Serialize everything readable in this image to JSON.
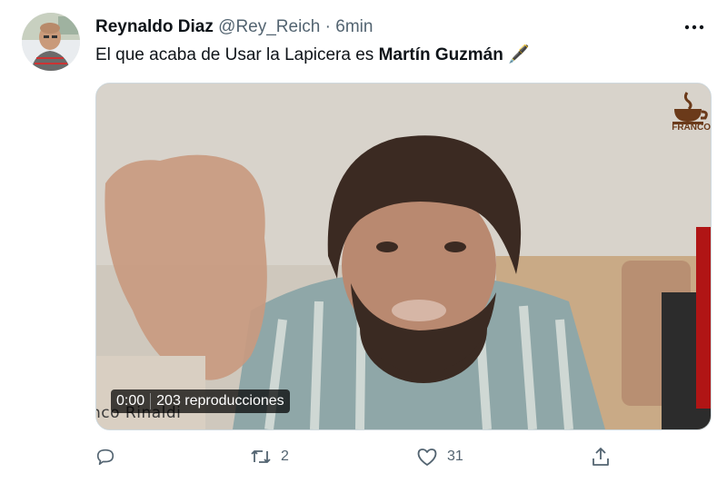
{
  "tweet": {
    "author_name": "Reynaldo Diaz",
    "handle": "@Rey_Reich",
    "separator": "·",
    "time": "6min",
    "text_prefix": "El que acaba de Usar la Lapicera es ",
    "text_bold": "Martín Guzmán",
    "emoji": "🖋️"
  },
  "media": {
    "elapsed": "0:00",
    "views": "203 reproducciones",
    "caption_overlay": "nco Rinaldi",
    "logo_text": "FRANCO"
  },
  "actions": {
    "reply_count": "",
    "retweet_count": "2",
    "like_count": "31"
  },
  "icons": [
    "more-icon",
    "reply-icon",
    "retweet-icon",
    "like-icon",
    "share-icon",
    "pen-emoji"
  ],
  "colors": {
    "text": "#0f1419",
    "muted": "#536471"
  }
}
